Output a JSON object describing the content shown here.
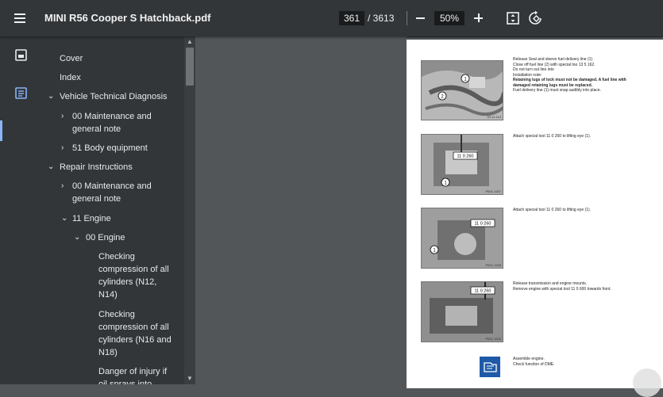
{
  "toolbar": {
    "menu_icon": "hamburger-menu-icon",
    "title": "MINI R56 Cooper S Hatchback.pdf",
    "page_current": "361",
    "page_total": "/ 3613",
    "zoom": "50%",
    "fit_icon": "fit-page-icon",
    "rotate_icon": "rotate-icon"
  },
  "rail": {
    "thumbnails_icon": "thumbnail-view-icon",
    "outline_icon": "document-outline-icon"
  },
  "outline": [
    {
      "label": "Cover"
    },
    {
      "label": "Index"
    },
    {
      "label": "Vehicle Technical Diagnosis",
      "chevron": "⌄"
    },
    {
      "label": "00 Maintenance and general note",
      "chevron": "›"
    },
    {
      "label": "51 Body equipment",
      "chevron": "›"
    },
    {
      "label": "Repair Instructions",
      "chevron": "⌄"
    },
    {
      "label": "00 Maintenance and general note",
      "chevron": "›"
    },
    {
      "label": "11 Engine",
      "chevron": "⌄"
    },
    {
      "label": "00 Engine",
      "chevron": "⌄"
    },
    {
      "label": "Checking compression of all cylinders (N12, N14)"
    },
    {
      "label": "Checking compression of all cylinders (N16 and N18)"
    },
    {
      "label": "Danger of injury if oil sprays into"
    }
  ],
  "page": {
    "step1": {
      "lines": [
        "Release Seal and sleeve fuel delivery line (1)",
        "Close off fuel line (2) with special too 13 5 162.",
        "Do not turn out line into",
        "Installation note:",
        "Retaining lugs of lock must not be damaged. A fuel line with",
        "damaged retaining lugs must be replaced.",
        "Fuel delivery line (1) must snap audibly into place."
      ],
      "callouts": [
        "1",
        "2"
      ],
      "fig_id": "00 11 214"
    },
    "step2": {
      "lines": [
        "Attach special tool 11 0 260 to lifting eye (1)."
      ],
      "callouts": [
        "11 0 260",
        "1"
      ],
      "fig_id": "P601 1207"
    },
    "step3": {
      "lines": [
        "Attach special tool 11 0 260 to lifting eye (1)."
      ],
      "callouts": [
        "11 0 260",
        "1"
      ],
      "fig_id": "P601 1205"
    },
    "step4": {
      "lines": [
        "Release transmission and engine mounts.",
        "Remove engine with special tool 11 0 600 towards front."
      ],
      "callouts": [
        "11 0 260"
      ],
      "fig_id": "P601 1203"
    },
    "step5": {
      "lines": [
        "Assemble engine.",
        "Check function of DME."
      ],
      "icon": "info-book-icon"
    }
  },
  "fab_icon": "floating-action-button"
}
